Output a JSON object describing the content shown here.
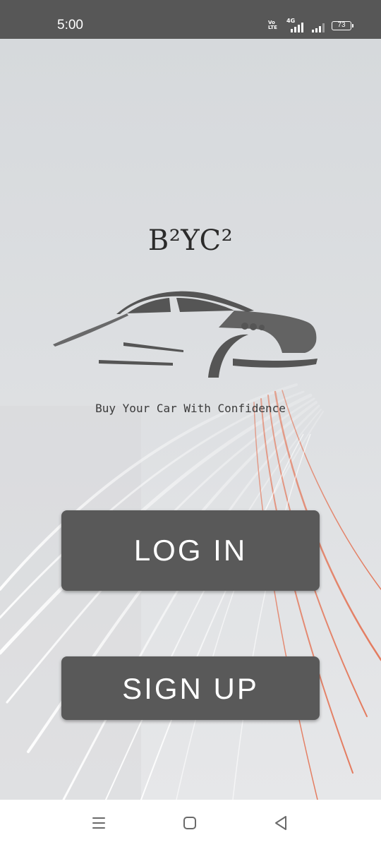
{
  "status_bar": {
    "time": "5:00",
    "volte": "Vo LTE",
    "network": "4G",
    "battery": "73"
  },
  "brand": {
    "title": "B²YC²",
    "tagline": "Buy Your Car With Confidence"
  },
  "buttons": {
    "login_label": "LOG IN",
    "signup_label": "SIGN UP"
  },
  "nav": {
    "icons": [
      "recent-apps-icon",
      "home-icon",
      "back-icon"
    ]
  },
  "colors": {
    "status_bar": "#575757",
    "button_bg": "#595959",
    "button_text": "#ffffff",
    "logo": "#555555",
    "light_trail_red": "#e4603c",
    "background": "#e2e3e5"
  }
}
